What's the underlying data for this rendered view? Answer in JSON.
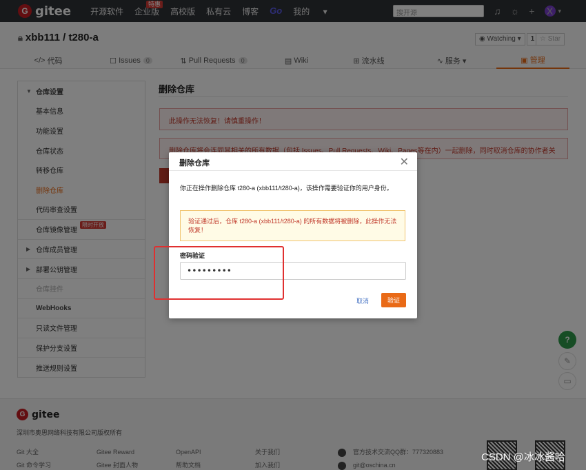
{
  "topnav": {
    "logo": "gitee",
    "links": [
      "开源软件",
      "企业版",
      "高校版",
      "私有云",
      "博客",
      "Go",
      "我的"
    ],
    "hot_badge": "特惠",
    "search_placeholder": "搜开源",
    "avatar": "X"
  },
  "repo": {
    "title": "xbb111 / t280-a",
    "watch_label": "Watching",
    "watch_count": "1",
    "star_label": "Star"
  },
  "tabs": [
    {
      "label": "代码",
      "icon": "code-icon"
    },
    {
      "label": "Issues",
      "count": "0"
    },
    {
      "label": "Pull Requests",
      "count": "0"
    },
    {
      "label": "Wiki"
    },
    {
      "label": "流水线"
    },
    {
      "label": "服务"
    },
    {
      "label": "管理"
    }
  ],
  "sidebar": {
    "group_title": "仓库设置",
    "items": [
      "基本信息",
      "功能设置",
      "仓库状态",
      "转移仓库",
      "删除仓库",
      "代码审查设置"
    ],
    "mirror": "仓库镜像管理",
    "mirror_badge": "限时开放",
    "members": "仓库成员管理",
    "deploy_keys": "部署公钥管理",
    "plugins": "仓库挂件",
    "webhooks": "WebHooks",
    "readonly": "只读文件管理",
    "protect": "保护分支设置",
    "push_rules": "推送规则设置"
  },
  "main": {
    "title": "删除仓库",
    "alert1": "此操作无法恢复！请慎重操作！",
    "alert2": "删除仓库将会连同其相关的所有数据（包括 Issues、Pull Requests、Wiki、Pages等在内）一起删除，同时取消仓库的协作者关联。"
  },
  "modal": {
    "title": "删除仓库",
    "text": "你正在操作删除仓库 t280-a (xbb111/t280-a)，该操作需要验证你的用户身份。",
    "warning": "验证通过后，仓库 t280-a (xbb111/t280-a) 的所有数据将被删除，此操作无法恢复！",
    "password_label": "密码验证",
    "password_value": "•••••••••",
    "cancel": "取消",
    "confirm": "验证"
  },
  "footer": {
    "logo": "gitee",
    "copyright": "深圳市奥思网络科技有限公司版权所有",
    "col1": [
      "Git 大全",
      "Git 命令学习"
    ],
    "col2": [
      "Gitee Reward",
      "Gitee 封面人物"
    ],
    "col3": [
      "OpenAPI",
      "帮助文档"
    ],
    "col4": [
      "关于我们",
      "加入我们"
    ],
    "qq": "官方技术交流QQ群：777320883",
    "email": "git@oschina.cn"
  },
  "watermark": "CSDN @冰冰酱哈",
  "colors": {
    "accent": "#e96a17",
    "danger": "#c0392b",
    "nav": "#2f3237",
    "highlight_box": "#e03030"
  }
}
